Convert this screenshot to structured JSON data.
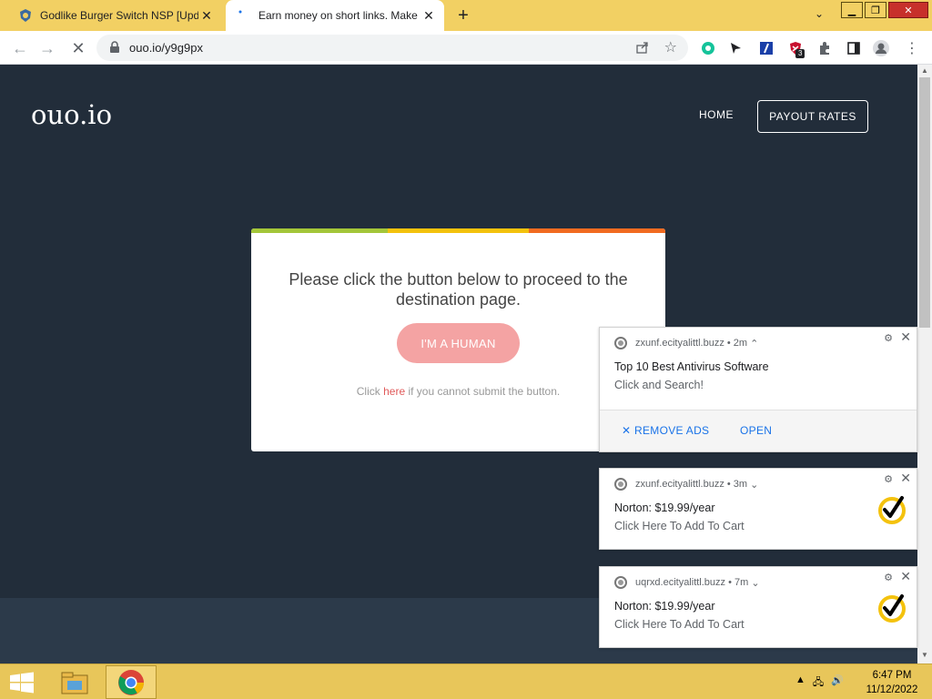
{
  "browser": {
    "tabs": [
      {
        "title": "Godlike Burger Switch NSP [Upd",
        "active": false
      },
      {
        "title": "Earn money on short links. Make",
        "active": true
      }
    ],
    "new_tab": "+",
    "url": "ouo.io/y9g9px",
    "extension_badge": "3",
    "accent_color": "#f2d063"
  },
  "site": {
    "logo": "ouo.io",
    "nav": {
      "home": "HOME",
      "payout": "PAYOUT RATES"
    },
    "card": {
      "message": "Please click the button below to proceed to the destination page.",
      "button": "I'M A HUMAN",
      "footer_pre": "Click ",
      "footer_link": "here",
      "footer_post": " if you cannot submit the button."
    }
  },
  "notifications": [
    {
      "source": "zxunf.ecityalittl.buzz",
      "age": "2m",
      "title": "Top 10 Best Antivirus Software",
      "body": "Click and Search!",
      "actions": [
        "REMOVE ADS",
        "OPEN"
      ]
    },
    {
      "source": "zxunf.ecityalittl.buzz",
      "age": "3m",
      "title": "Norton: $19.99/year",
      "body": "Click Here To Add To Cart"
    },
    {
      "source": "uqrxd.ecityalittl.buzz",
      "age": "7m",
      "title": "Norton: $19.99/year",
      "body": "Click Here To Add To Cart"
    }
  ],
  "taskbar": {
    "time": "6:47 PM",
    "date": "11/12/2022"
  }
}
